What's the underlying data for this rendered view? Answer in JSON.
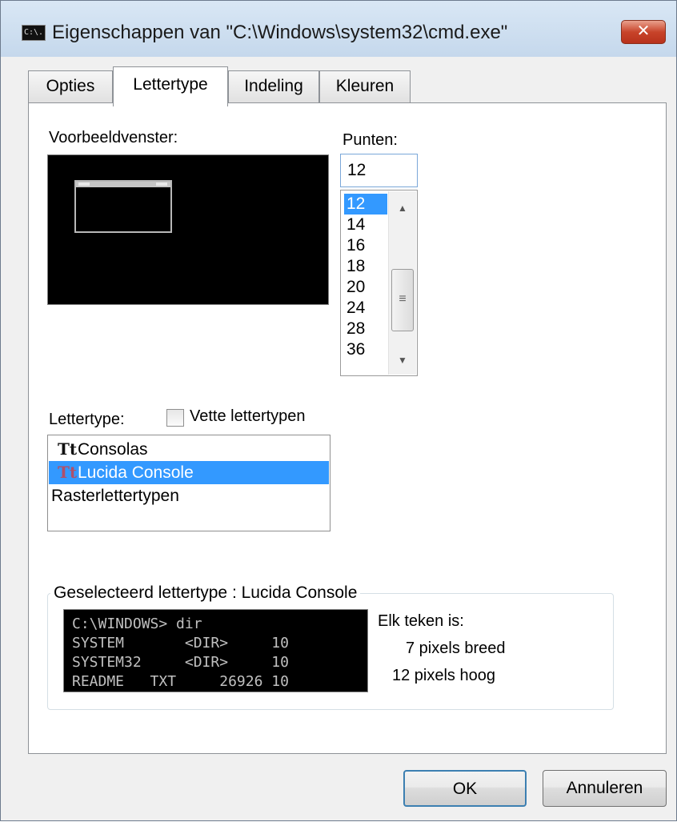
{
  "window": {
    "title": "Eigenschappen van \"C:\\Windows\\system32\\cmd.exe\"",
    "app_icon_text": "C:\\.",
    "close_glyph": "✕"
  },
  "tabs": [
    {
      "label": "Opties",
      "active": false
    },
    {
      "label": "Lettertype",
      "active": true
    },
    {
      "label": "Indeling",
      "active": false
    },
    {
      "label": "Kleuren",
      "active": false
    }
  ],
  "preview": {
    "label": "Voorbeeldvenster:"
  },
  "points": {
    "label": "Punten:",
    "value": "12",
    "options": [
      "12",
      "14",
      "16",
      "18",
      "20",
      "24",
      "28",
      "36"
    ],
    "selected": "12",
    "scroll_up_glyph": "▲",
    "scroll_down_glyph": "▼",
    "thumb_grip": "≡"
  },
  "font": {
    "label": "Lettertype:",
    "bold_checkbox_label": "Vette lettertypen",
    "bold_checked": false,
    "icon_glyph": "Tt",
    "items": [
      {
        "label": "Consolas",
        "truetype": true,
        "selected": false
      },
      {
        "label": "Lucida Console",
        "truetype": true,
        "selected": true
      },
      {
        "label": "Rasterlettertypen",
        "truetype": false,
        "selected": false
      }
    ]
  },
  "selected_font": {
    "group_title": "Geselecteerd lettertype : Lucida Console",
    "sample_lines": [
      "C:\\WINDOWS> dir",
      "SYSTEM       <DIR>     10",
      "SYSTEM32     <DIR>     10",
      "README   TXT     26926 10"
    ],
    "char_info_label": "Elk teken is:",
    "width_text": "7 pixels breed",
    "height_text": "12 pixels hoog"
  },
  "buttons": {
    "ok": "OK",
    "cancel": "Annuleren"
  },
  "colors": {
    "selection": "#3399ff",
    "close_button": "#c8442a",
    "console_background": "#000000",
    "console_text": "#c0c0c0"
  }
}
